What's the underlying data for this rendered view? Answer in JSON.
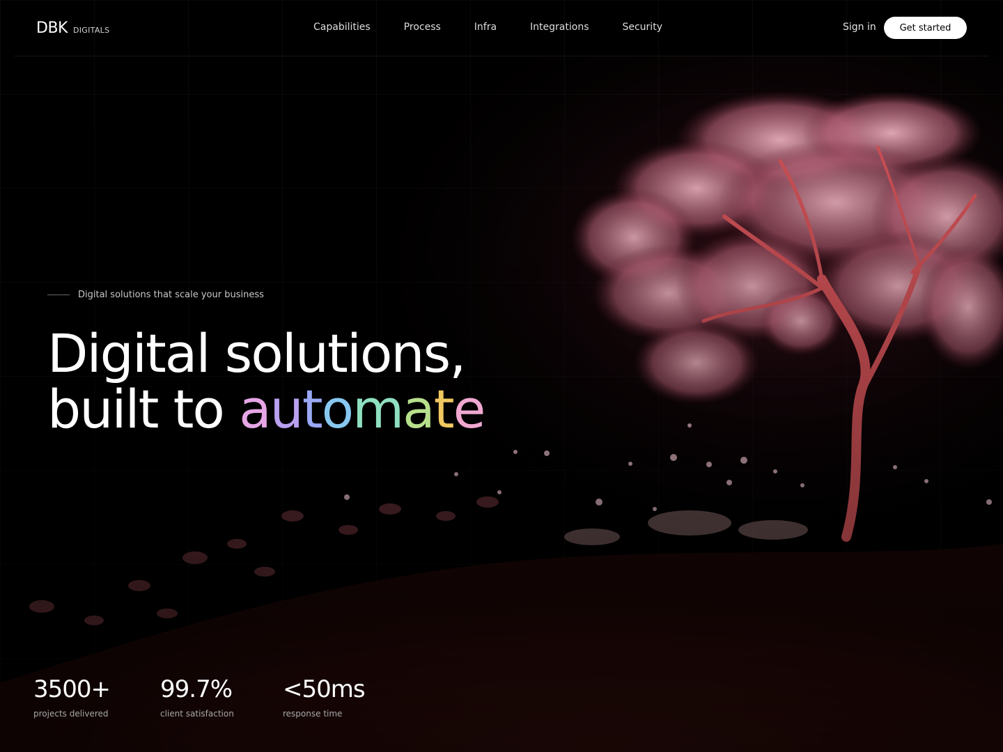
{
  "brand": {
    "name": "DBK",
    "sub": "DIGITALS"
  },
  "nav": {
    "links": [
      "Capabilities",
      "Process",
      "Infra",
      "Integrations",
      "Security"
    ],
    "sign_in": "Sign in",
    "cta": "Get started"
  },
  "hero": {
    "eyebrow": "Digital solutions that scale your business",
    "headline_line1": "Digital solutions,",
    "headline_line2_prefix": "built to ",
    "headline_accent_letters": [
      "a",
      "u",
      "t",
      "o",
      "m",
      "a",
      "t",
      "e"
    ],
    "accent_colors": [
      "#e6a6e6",
      "#b9a0f0",
      "#9aa8f5",
      "#88c8f0",
      "#8fe0c0",
      "#b8e08c",
      "#f0c860",
      "#f0a8d0"
    ]
  },
  "stats": [
    {
      "value": "3500+",
      "label": "projects delivered"
    },
    {
      "value": "99.7%",
      "label": "client satisfaction"
    },
    {
      "value": "<50ms",
      "label": "response time"
    }
  ],
  "colors": {
    "background": "#000000",
    "tree": "#e07a8c",
    "trunk": "#d0504a",
    "ground": "#5a1a14"
  }
}
